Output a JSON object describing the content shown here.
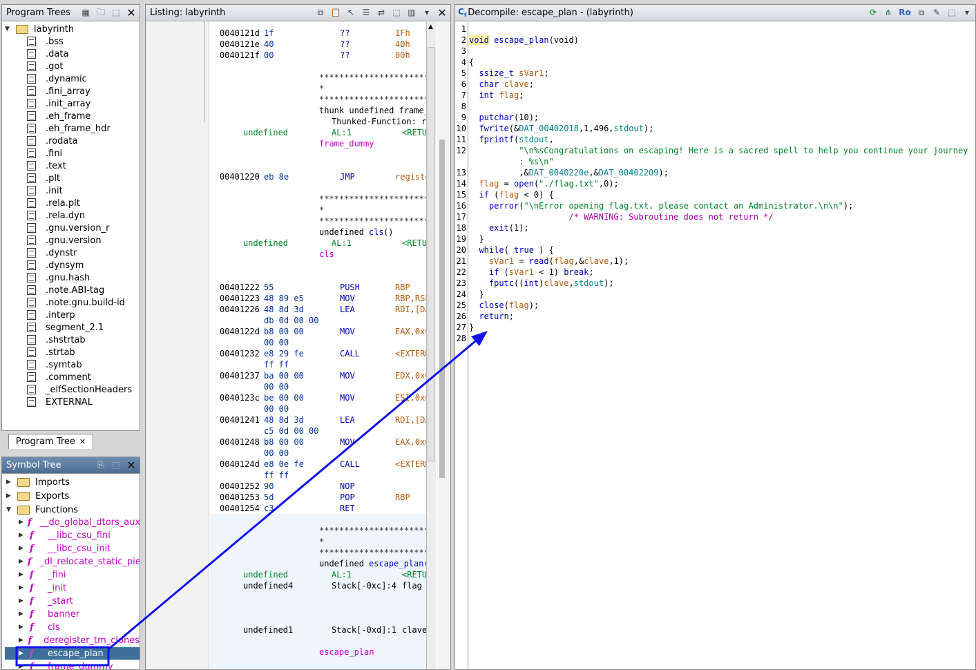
{
  "program_trees": {
    "title": "Program Trees",
    "root": "labyrinth",
    "sections": [
      ".bss",
      ".data",
      ".got",
      ".dynamic",
      ".fini_array",
      ".init_array",
      ".eh_frame",
      ".eh_frame_hdr",
      ".rodata",
      ".fini",
      ".text",
      ".plt",
      ".init",
      ".rela.plt",
      ".rela.dyn",
      ".gnu.version_r",
      ".gnu.version",
      ".dynstr",
      ".dynsym",
      ".gnu.hash",
      ".note.ABI-tag",
      ".note.gnu.build-id",
      ".interp",
      "segment_2.1",
      ".shstrtab",
      ".strtab",
      ".symtab",
      ".comment",
      "_elfSectionHeaders",
      "EXTERNAL"
    ],
    "tab_label": "Program Tree"
  },
  "symbol_tree": {
    "title": "Symbol Tree",
    "folders": [
      "Imports",
      "Exports",
      "Functions"
    ],
    "functions": [
      "__do_global_dtors_aux",
      "__libc_csu_fini",
      "__libc_csu_init",
      "_dl_relocate_static_pie",
      "_fini",
      "_init",
      "_start",
      "banner",
      "cls",
      "deregister_tm_clones",
      "escape_plan",
      "frame_dummy"
    ],
    "selected": "escape_plan"
  },
  "listing": {
    "title": "Listing:  labyrinth",
    "lines": [
      {
        "a": "0040121d",
        "b": "1f",
        "m": "??",
        "o": "1Fh"
      },
      {
        "a": "0040121e",
        "b": "40",
        "m": "??",
        "o": "40h"
      },
      {
        "a": "0040121f",
        "b": "00",
        "m": "??",
        "o": "00h"
      }
    ],
    "stars": "**************************",
    "star_single": "*",
    "thunk_text": "thunk undefined frame_d",
    "thunked_fn": "Thunked-Function: re",
    "undefined": "undefined",
    "al1": "AL:1",
    "retu": "<RETU",
    "frame_dummy": "frame_dummy",
    "jmp_addr": "00401220",
    "jmp_bytes": "eb 8e",
    "jmp": "JMP",
    "jmp_op": "registe",
    "cls_sig_pre": "undefined ",
    "cls_sig_fn": "cls",
    "cls_sig_post": "()",
    "cls_label": "cls",
    "instructions": [
      {
        "a": "00401222",
        "b": "55",
        "m": "PUSH",
        "o": "RBP"
      },
      {
        "a": "00401223",
        "b": "48 89 e5",
        "m": "MOV",
        "o": "RBP,RSP"
      },
      {
        "a": "00401226",
        "b": "48 8d 3d",
        "m": "LEA",
        "o": "RDI,[DA"
      },
      {
        "a": "",
        "b": "db 0d 00 00",
        "m": "",
        "o": ""
      },
      {
        "a": "0040122d",
        "b": "b8 00 00",
        "m": "MOV",
        "o": "EAX,0x0"
      },
      {
        "a": "",
        "b": "00 00",
        "m": "",
        "o": ""
      },
      {
        "a": "00401232",
        "b": "e8 29 fe",
        "m": "CALL",
        "o": "<EXTERN"
      },
      {
        "a": "",
        "b": "ff ff",
        "m": "",
        "o": ""
      },
      {
        "a": "00401237",
        "b": "ba 00 00",
        "m": "MOV",
        "o": "EDX,0x0"
      },
      {
        "a": "",
        "b": "00 00",
        "m": "",
        "o": ""
      },
      {
        "a": "0040123c",
        "b": "be 00 00",
        "m": "MOV",
        "o": "ESI,0x0"
      },
      {
        "a": "",
        "b": "00 00",
        "m": "",
        "o": ""
      },
      {
        "a": "00401241",
        "b": "48 8d 3d",
        "m": "LEA",
        "o": "RDI,[DA"
      },
      {
        "a": "",
        "b": "c5 0d 00 00",
        "m": "",
        "o": ""
      },
      {
        "a": "00401248",
        "b": "b8 00 00",
        "m": "MOV",
        "o": "EAX,0x0"
      },
      {
        "a": "",
        "b": "00 00",
        "m": "",
        "o": ""
      },
      {
        "a": "0040124d",
        "b": "e8 0e fe",
        "m": "CALL",
        "o": "<EXTERN"
      },
      {
        "a": "",
        "b": "ff ff",
        "m": "",
        "o": ""
      },
      {
        "a": "00401252",
        "b": "90",
        "m": "NOP",
        "o": ""
      },
      {
        "a": "00401253",
        "b": "5d",
        "m": "POP",
        "o": "RBP"
      },
      {
        "a": "00401254",
        "b": "c3",
        "m": "RET",
        "o": ""
      }
    ],
    "escape_sig_pre": "undefined ",
    "escape_sig_fn": "escape_plan(",
    "undefined4": "undefined4",
    "stack_c": "Stack[-0xc]:4",
    "flag": "flag",
    "undefined1": "undefined1",
    "stack_d": "Stack[-0xd]:1",
    "clave": "clave",
    "escape_label": "escape_plan"
  },
  "decompile": {
    "title": "Decompile: escape_plan -  (labyrinth)",
    "ro": "Ro",
    "line_numbers": [
      "1",
      "2",
      "3",
      "4",
      "5",
      "6",
      "7",
      "8",
      "9",
      "10",
      "11",
      "12",
      "",
      "13",
      "14",
      "15",
      "16",
      "17",
      "18",
      "19",
      "20",
      "21",
      "22",
      "23",
      "24",
      "25",
      "26",
      "27",
      "28"
    ],
    "code": {
      "l2_type": "void",
      "l2_name": "escape_plan",
      "l2_args": "(void)",
      "l4": "{",
      "l5_type": "ssize_t",
      "l5_var": "sVar1",
      "l6_type": "char",
      "l6_var": "clave",
      "l7_type": "int",
      "l7_var": "flag",
      "l9_fn": "putchar",
      "l9_args": "(10);",
      "l10_fn": "fwrite",
      "l10_a": "(&",
      "l10_g": "DAT_00402018",
      "l10_b": ",1,496,",
      "l10_c": "stdout",
      "l10_d": ");",
      "l11_fn": "fprintf",
      "l11_a": "(",
      "l11_b": "stdout",
      "l11_c": ",",
      "l12_str": "\"\\n%sCongratulations on escaping! Here is a sacred spell to help you continue your journey",
      "l12b_str": ": %s\\n\"",
      "l13_a": ",&",
      "l13_g1": "DAT_0040220e",
      "l13_b": ",&",
      "l13_g2": "DAT_00402209",
      "l13_c": ");",
      "l14_var": "flag",
      "l14_a": " = ",
      "l14_fn": "open",
      "l14_b": "(",
      "l14_str": "\"./flag.txt\"",
      "l14_c": ",0);",
      "l15_kw": "if",
      "l15_a": " (",
      "l15_var": "flag",
      "l15_b": " < 0) {",
      "l16_fn": "perror",
      "l16_a": "(",
      "l16_str": "\"\\nError opening flag.txt, please contact an Administrator.\\n\\n\"",
      "l16_b": ");",
      "l17_cmt": "/* WARNING: Subroutine does not return */",
      "l18_fn": "exit",
      "l18_a": "(1);",
      "l19": "}",
      "l20_kw": "while",
      "l20_a": "( ",
      "l20_kw2": "true",
      "l20_b": " ) {",
      "l21_var": "sVar1",
      "l21_a": " = ",
      "l21_fn": "read",
      "l21_b": "(",
      "l21_v2": "flag",
      "l21_c": ",&",
      "l21_v3": "clave",
      "l21_d": ",1);",
      "l22_kw": "if",
      "l22_a": " (",
      "l22_var": "sVar1",
      "l22_b": " < 1) ",
      "l22_kw2": "break",
      "l22_c": ";",
      "l23_fn": "fputc",
      "l23_a": "((",
      "l23_type": "int",
      "l23_b": ")",
      "l23_var": "clave",
      "l23_c": ",",
      "l23_d": "stdout",
      "l23_e": ");",
      "l24": "}",
      "l25_fn": "close",
      "l25_a": "(",
      "l25_var": "flag",
      "l25_b": ");",
      "l26_kw": "return",
      "l26_a": ";",
      "l27": "}"
    }
  },
  "colors": {
    "annotation_blue": "#1010ee",
    "selection_bg": "#3d6f9a",
    "function_magenta": "#c800c8"
  }
}
